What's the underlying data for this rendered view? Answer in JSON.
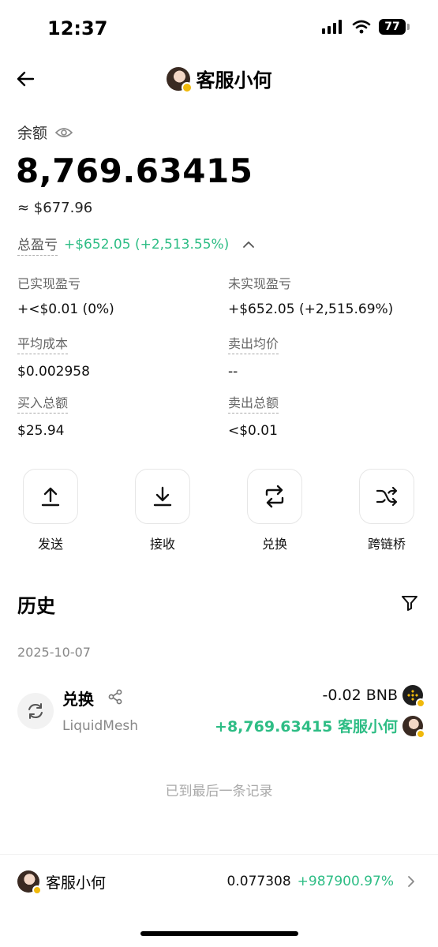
{
  "status": {
    "time": "12:37",
    "battery": "77"
  },
  "nav": {
    "title": "客服小何"
  },
  "balance": {
    "label": "余额",
    "value": "8,769.63415",
    "usd": "≈ $677.96"
  },
  "pnl": {
    "label": "总盈亏",
    "value": "+$652.05 (+2,513.55%)"
  },
  "stats": {
    "realized_label": "已实现盈亏",
    "realized_value": "+<$0.01 (0%)",
    "unrealized_label": "未实现盈亏",
    "unrealized_value": "+$652.05 (+2,515.69%)",
    "avg_cost_label": "平均成本",
    "avg_cost_value": "$0.002958",
    "avg_sell_label": "卖出均价",
    "avg_sell_value": "--",
    "buy_total_label": "买入总额",
    "buy_total_value": "$25.94",
    "sell_total_label": "卖出总额",
    "sell_total_value": "<$0.01"
  },
  "actions": {
    "send": "发送",
    "receive": "接收",
    "swap": "兑换",
    "bridge": "跨链桥"
  },
  "history": {
    "title": "历史",
    "date": "2025-10-07",
    "tx": {
      "type": "兑换",
      "source": "LiquidMesh",
      "out": "-0.02 BNB",
      "in": "+8,769.63415 客服小何"
    },
    "end_note": "已到最后一条记录"
  },
  "bottom": {
    "name": "客服小何",
    "price": "0.077308",
    "change": "+987900.97%"
  },
  "colors": {
    "green": "#2ebd85",
    "bnb": "#f0b90b"
  },
  "icons": [
    "back-arrow-icon",
    "eye-icon",
    "chevron-up-icon",
    "upload-icon",
    "download-icon",
    "swap-icon",
    "shuffle-icon",
    "filter-icon",
    "share-icon",
    "refresh-icon",
    "chevron-right-icon"
  ]
}
